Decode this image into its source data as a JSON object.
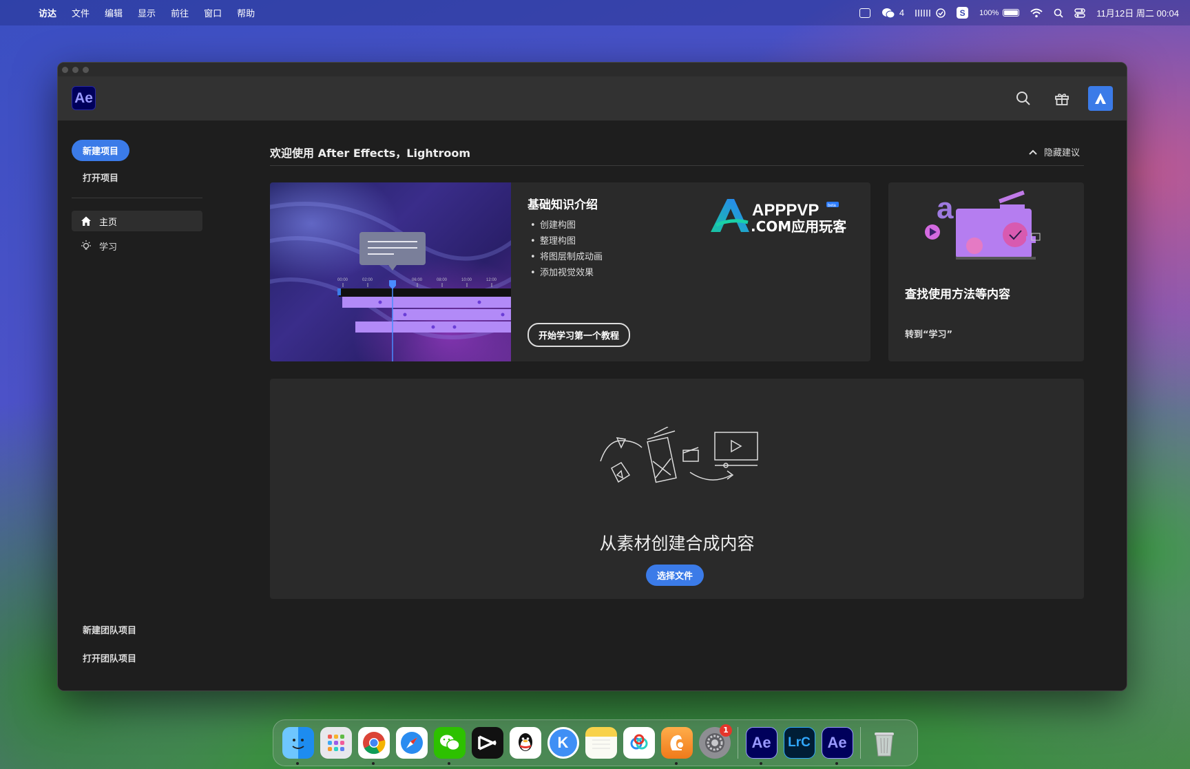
{
  "menubar": {
    "app_name": "访达",
    "items": [
      "文件",
      "编辑",
      "显示",
      "前往",
      "窗口",
      "帮助"
    ],
    "wechat_count": "4",
    "battery": "100%",
    "datetime": "11月12日 周二  00:04"
  },
  "app": {
    "logo": "Ae",
    "sidebar": {
      "new_project": "新建项目",
      "open_project": "打开项目",
      "nav": [
        {
          "label": "主页",
          "icon": "home-icon",
          "active": true
        },
        {
          "label": "学习",
          "icon": "lightbulb-icon",
          "active": false
        }
      ],
      "new_team_project": "新建团队项目",
      "open_team_project": "打开团队项目"
    },
    "main": {
      "welcome": "欢迎使用 After Effects，Lightroom",
      "hide_suggestions": "隐藏建议",
      "learn_card": {
        "title": "基础知识介绍",
        "bullets": [
          "创建构图",
          "整理构图",
          "将图层制成动画",
          "添加视觉效果"
        ],
        "button": "开始学习第一个教程",
        "timeline_ticks": [
          "00:00",
          "02:00",
          "04:00",
          "06:00",
          "08:00",
          "10:00",
          "12:00"
        ],
        "watermark_line1": "APPPVP",
        "watermark_line2": ".COM应用玩客",
        "watermark_badge": "beta"
      },
      "find_card": {
        "title": "查找使用方法等内容",
        "link": "转到“学习”"
      },
      "create_card": {
        "title": "从素材创建合成内容",
        "button": "选择文件"
      }
    }
  },
  "dock": {
    "items": [
      {
        "name": "finder",
        "label": ""
      },
      {
        "name": "launchpad",
        "label": ""
      },
      {
        "name": "chrome",
        "label": ""
      },
      {
        "name": "safari",
        "label": ""
      },
      {
        "name": "wechat",
        "label": ""
      },
      {
        "name": "capcut",
        "label": ""
      },
      {
        "name": "qq",
        "label": ""
      },
      {
        "name": "kuaihuo",
        "label": "K"
      },
      {
        "name": "notes",
        "label": ""
      },
      {
        "name": "baidu-netdisk",
        "label": ""
      },
      {
        "name": "squirrel",
        "label": ""
      },
      {
        "name": "system-settings",
        "label": ""
      },
      {
        "name": "after-effects-2",
        "label": "Ae"
      },
      {
        "name": "lightroom-classic",
        "label": "LrC"
      },
      {
        "name": "after-effects",
        "label": "Ae"
      },
      {
        "name": "trash",
        "label": ""
      }
    ],
    "settings_badge": "1"
  },
  "colors": {
    "accent": "#3b7be8",
    "ae_bg": "#00005b",
    "ae_fg": "#9999ff",
    "lrc_bg": "#001e36",
    "lrc_fg": "#31a8ff"
  }
}
